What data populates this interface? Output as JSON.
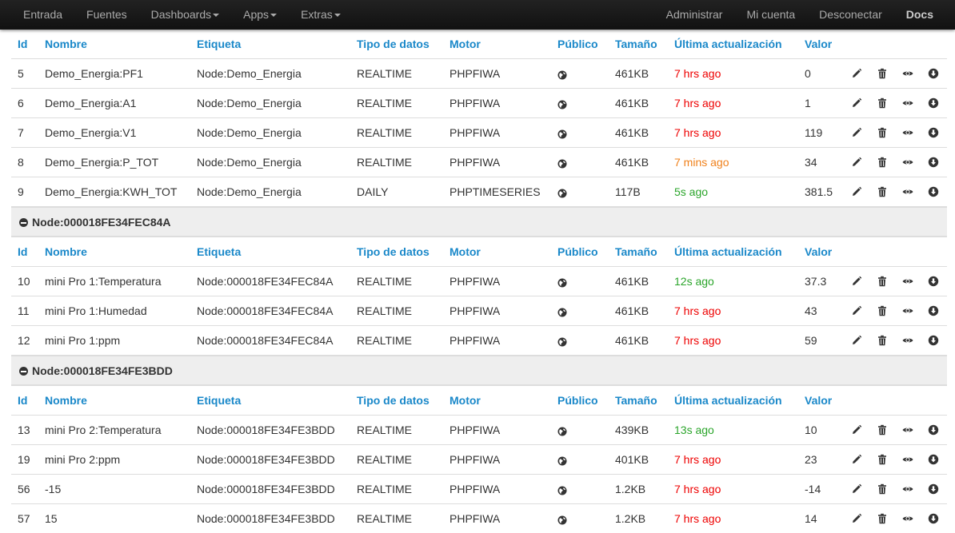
{
  "navbar": {
    "left": [
      {
        "label": "Entrada",
        "caret": false
      },
      {
        "label": "Fuentes",
        "caret": false
      },
      {
        "label": "Dashboards",
        "caret": true
      },
      {
        "label": "Apps",
        "caret": true
      },
      {
        "label": "Extras",
        "caret": true
      }
    ],
    "right": [
      {
        "label": "Administrar"
      },
      {
        "label": "Mi cuenta"
      },
      {
        "label": "Desconectar"
      },
      {
        "label": "Docs"
      }
    ]
  },
  "columns": {
    "id": "Id",
    "name": "Nombre",
    "tag": "Etiqueta",
    "type": "Tipo de datos",
    "engine": "Motor",
    "public": "Público",
    "size": "Tamaño",
    "updated": "Última actualización",
    "value": "Valor"
  },
  "colors": {
    "header": "#1a88c9",
    "stale": "#e00000",
    "warning": "#f0801a",
    "fresh": "#2ba52b"
  },
  "icons": {
    "public": "globe-icon",
    "edit": "pencil-icon",
    "delete": "trash-icon",
    "preview": "eye-icon",
    "download": "download-icon"
  },
  "groups": [
    {
      "name": "",
      "rows": [
        {
          "id": "5",
          "name": "Demo_Energia:PF1",
          "tag": "Node:Demo_Energia",
          "type": "REALTIME",
          "engine": "PHPFIWA",
          "size": "461KB",
          "updated": "7 hrs ago",
          "status": "red",
          "value": "0"
        },
        {
          "id": "6",
          "name": "Demo_Energia:A1",
          "tag": "Node:Demo_Energia",
          "type": "REALTIME",
          "engine": "PHPFIWA",
          "size": "461KB",
          "updated": "7 hrs ago",
          "status": "red",
          "value": "1"
        },
        {
          "id": "7",
          "name": "Demo_Energia:V1",
          "tag": "Node:Demo_Energia",
          "type": "REALTIME",
          "engine": "PHPFIWA",
          "size": "461KB",
          "updated": "7 hrs ago",
          "status": "red",
          "value": "119"
        },
        {
          "id": "8",
          "name": "Demo_Energia:P_TOT",
          "tag": "Node:Demo_Energia",
          "type": "REALTIME",
          "engine": "PHPFIWA",
          "size": "461KB",
          "updated": "7 mins ago",
          "status": "orange",
          "value": "34"
        },
        {
          "id": "9",
          "name": "Demo_Energia:KWH_TOT",
          "tag": "Node:Demo_Energia",
          "type": "DAILY",
          "engine": "PHPTIMESERIES",
          "size": "117B",
          "updated": "5s ago",
          "status": "green",
          "value": "381.5"
        }
      ]
    },
    {
      "name": "Node:000018FE34FEC84A",
      "rows": [
        {
          "id": "10",
          "name": "mini Pro 1:Temperatura",
          "tag": "Node:000018FE34FEC84A",
          "type": "REALTIME",
          "engine": "PHPFIWA",
          "size": "461KB",
          "updated": "12s ago",
          "status": "green",
          "value": "37.3"
        },
        {
          "id": "11",
          "name": "mini Pro 1:Humedad",
          "tag": "Node:000018FE34FEC84A",
          "type": "REALTIME",
          "engine": "PHPFIWA",
          "size": "461KB",
          "updated": "7 hrs ago",
          "status": "red",
          "value": "43"
        },
        {
          "id": "12",
          "name": "mini Pro 1:ppm",
          "tag": "Node:000018FE34FEC84A",
          "type": "REALTIME",
          "engine": "PHPFIWA",
          "size": "461KB",
          "updated": "7 hrs ago",
          "status": "red",
          "value": "59"
        }
      ]
    },
    {
      "name": "Node:000018FE34FE3BDD",
      "rows": [
        {
          "id": "13",
          "name": "mini Pro 2:Temperatura",
          "tag": "Node:000018FE34FE3BDD",
          "type": "REALTIME",
          "engine": "PHPFIWA",
          "size": "439KB",
          "updated": "13s ago",
          "status": "green",
          "value": "10"
        },
        {
          "id": "19",
          "name": "mini Pro 2:ppm",
          "tag": "Node:000018FE34FE3BDD",
          "type": "REALTIME",
          "engine": "PHPFIWA",
          "size": "401KB",
          "updated": "7 hrs ago",
          "status": "red",
          "value": "23"
        },
        {
          "id": "56",
          "name": "-15",
          "tag": "Node:000018FE34FE3BDD",
          "type": "REALTIME",
          "engine": "PHPFIWA",
          "size": "1.2KB",
          "updated": "7 hrs ago",
          "status": "red",
          "value": "-14"
        },
        {
          "id": "57",
          "name": "15",
          "tag": "Node:000018FE34FE3BDD",
          "type": "REALTIME",
          "engine": "PHPFIWA",
          "size": "1.2KB",
          "updated": "7 hrs ago",
          "status": "red",
          "value": "14"
        }
      ]
    }
  ]
}
